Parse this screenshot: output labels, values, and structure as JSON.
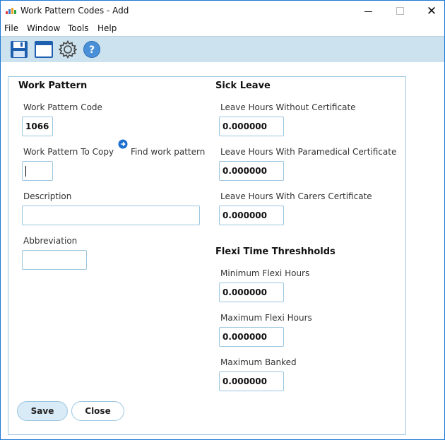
{
  "window": {
    "title": "Work Pattern Codes - Add",
    "close_glyph": "✕"
  },
  "menu": {
    "items": [
      "File",
      "Window",
      "Tools",
      "Help"
    ]
  },
  "toolbar": {
    "icons": [
      "save-icon",
      "window-icon",
      "settings-gear-icon",
      "help-icon"
    ]
  },
  "work_pattern": {
    "section_title": "Work Pattern",
    "code_label": "Work Pattern Code",
    "code_value": "1066",
    "copy_label": "Work Pattern To Copy",
    "copy_value": "",
    "find_label": "Find work pattern",
    "description_label": "Description",
    "description_value": "",
    "abbreviation_label": "Abbreviation",
    "abbreviation_value": ""
  },
  "sick_leave": {
    "section_title": "Sick Leave",
    "without_cert_label": "Leave Hours Without Certificate",
    "without_cert_value": "0.000000",
    "paramedical_label": "Leave Hours With Paramedical Certificate",
    "paramedical_value": "0.000000",
    "carers_label": "Leave Hours With Carers Certificate",
    "carers_value": "0.000000"
  },
  "flexi": {
    "section_title": "Flexi Time Threshholds",
    "min_label": "Minimum Flexi Hours",
    "min_value": "0.000000",
    "max_label": "Maximum Flexi Hours",
    "max_value": "0.000000",
    "banked_label": "Maximum Banked",
    "banked_value": "0.000000"
  },
  "buttons": {
    "save": "Save",
    "close": "Close"
  },
  "colors": {
    "accent": "#1e78d6",
    "toolbar_bg": "#cce3ef",
    "field_border": "#9cc6e0"
  }
}
